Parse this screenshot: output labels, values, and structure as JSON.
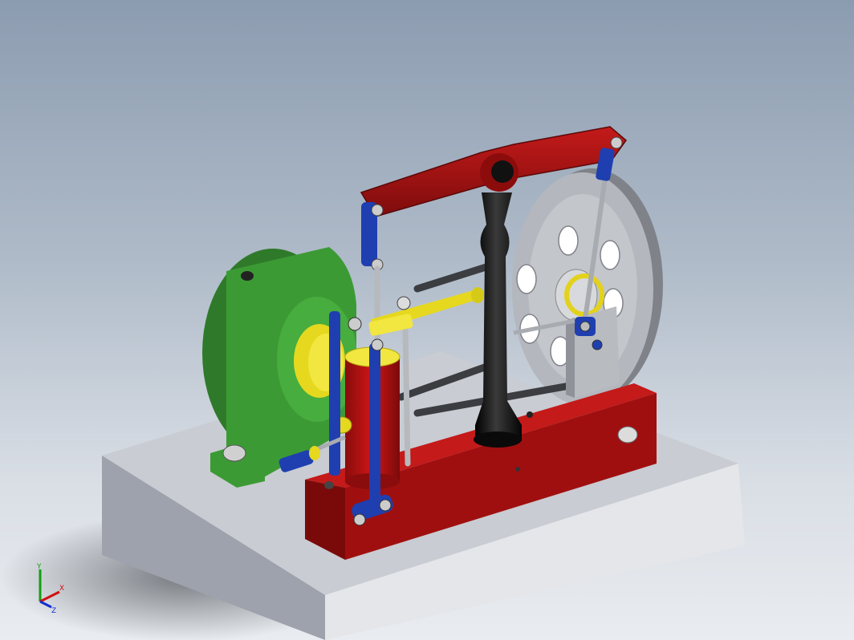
{
  "viewport": {
    "background_top": "#8c9cb0",
    "background_bottom": "#e9ecf0"
  },
  "model": {
    "base_color": "#c8ccd4",
    "frame_color": "#9e0f0f",
    "beam_color": "#b01414",
    "column_color": "#111111",
    "bearing_color": "#3c9a35",
    "link_color": "#1f3fb0",
    "crosshead_color": "#e6d81e",
    "flywheel_color": "#b4b7bd"
  },
  "triad": {
    "x_label": "X",
    "y_label": "Y",
    "z_label": "Z",
    "x_color": "#d01010",
    "y_color": "#10a010",
    "z_color": "#1030d0"
  }
}
